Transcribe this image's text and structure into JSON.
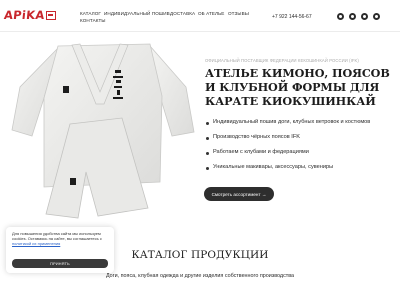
{
  "header": {
    "logo_text": "APiKA",
    "nav": [
      "КАТАЛОГ",
      "ИНДИВИДУАЛЬНЫЙ ПОШИВ",
      "ДОСТАВКА",
      "ОБ АТЕЛЬЕ",
      "ОТЗЫВЫ",
      "КОНТАКТЫ"
    ],
    "phone": "+7 922 144-56-67",
    "social_icons": [
      "whatsapp-icon",
      "viber-icon",
      "telegram-icon",
      "vk-icon"
    ]
  },
  "hero": {
    "subtitle": "ОФИЦИАЛЬНЫЙ ПОСТАВЩИК ФЕДЕРАЦИИ КЕКОШИНКАЙ РОССИИ (IFK)",
    "title": "АТЕЛЬЕ КИМОНО, ПОЯСОВ И КЛУБНОЙ ФОРМЫ ДЛЯ КАРАТЕ КИОКУШИНКАЙ",
    "features": [
      "Индивидуальный пошив доги, клубных ветровок и костюмов",
      "Производство чёрных поясов IFK",
      "Работаем с клубами и федерациями",
      "Уникальные макивары, аксессуары, сувениры"
    ],
    "button": "Смотреть ассортимент →"
  },
  "catalog": {
    "title": "КАТАЛОГ ПРОДУКЦИИ",
    "subtitle": "Доги, пояса, клубная одежда и другие изделия собственного производства"
  },
  "cookie": {
    "text": "Для повышения удобства сайта мы используем cookies. Оставаясь на сайте, вы соглашаетесь с",
    "link": "политикой их применения",
    "button": "ПРИНЯТЬ"
  },
  "colors": {
    "brand_red": "#c8272d",
    "dark": "#2e2e2e"
  }
}
